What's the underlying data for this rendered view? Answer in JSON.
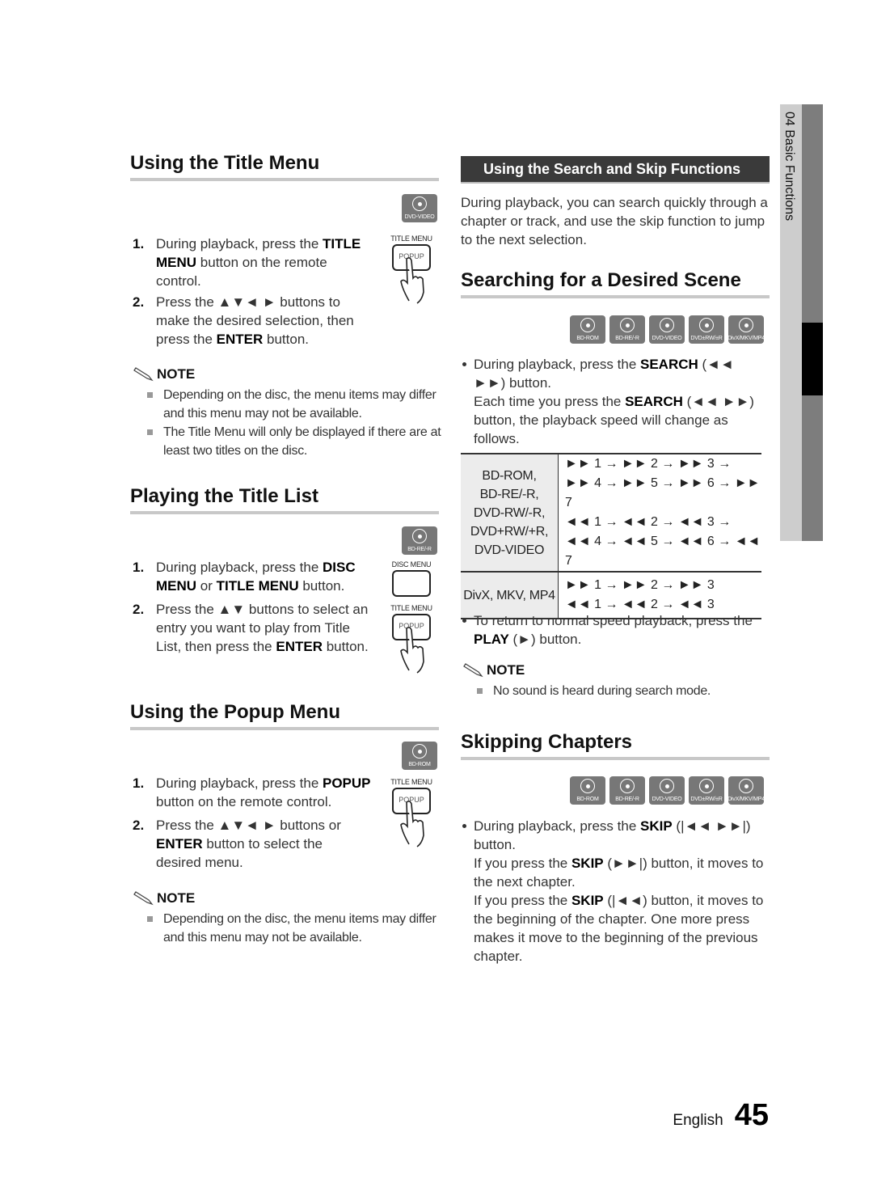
{
  "left": {
    "title_menu": {
      "heading": "Using the Title Menu",
      "disc_badge": "DVD-VIDEO",
      "remote_caption": "TITLE MENU",
      "remote_button": "POPUP",
      "steps": [
        {
          "num": "1.",
          "pre": "During playback, press the ",
          "bold": "TITLE MENU",
          "post": " button on the remote control."
        },
        {
          "num": "2.",
          "pre": "Press the ▲▼◄ ► buttons to make the desired selection, then press the ",
          "bold": "ENTER",
          "post": " button."
        }
      ],
      "note_label": "NOTE",
      "notes": [
        "Depending on the disc, the menu items may differ and this menu may not be available.",
        "The Title Menu will only be displayed if there are at least two titles on the disc."
      ]
    },
    "title_list": {
      "heading": "Playing the Title List",
      "disc_badge": "BD-RE/-R",
      "remote1_caption": "DISC MENU",
      "remote2_caption": "TITLE MENU",
      "remote2_button": "POPUP",
      "step1": {
        "num": "1.",
        "pre": "During playback, press the ",
        "bold1": "DISC MENU",
        "mid": " or ",
        "bold2": "TITLE MENU",
        "post": " button."
      },
      "step2": {
        "num": "2.",
        "pre": "Press the ▲▼ buttons to select an entry you want to play from Title List, then press the ",
        "bold": "ENTER",
        "post": " button."
      }
    },
    "popup_menu": {
      "heading": "Using the Popup Menu",
      "disc_badge": "BD-ROM",
      "remote_caption": "TITLE MENU",
      "remote_button": "POPUP",
      "step1": {
        "num": "1.",
        "pre": "During playback, press the ",
        "bold": "POPUP",
        "post": " button on the remote control."
      },
      "step2": {
        "num": "2.",
        "pre": "Press the ▲▼◄ ► buttons or ",
        "bold": "ENTER",
        "post": " button to select the desired menu."
      },
      "note_label": "NOTE",
      "notes": [
        "Depending on the disc, the menu items may differ and this menu may not be available."
      ]
    }
  },
  "right": {
    "banner": "Using the Search and Skip Functions",
    "intro": "During playback, you can search quickly through a chapter or track, and use the skip function to jump to the next selection.",
    "search": {
      "heading": "Searching for a Desired Scene",
      "disc_badges": [
        "BD-ROM",
        "BD-RE/-R",
        "DVD-VIDEO",
        "DVD±RW/±R",
        "DivX/MKV/MP4"
      ],
      "bullet1": {
        "pre": "During playback, press the ",
        "bold": "SEARCH",
        "post": " (◄◄ ►►) button.",
        "pre2": "Each time you press the ",
        "bold2": "SEARCH",
        "post2": " (◄◄ ►►) button, the playback speed will change as follows."
      },
      "table": [
        {
          "category": [
            "BD-ROM,",
            "BD-RE/-R,",
            "DVD-RW/-R,",
            "DVD+RW/+R,",
            "DVD-VIDEO"
          ],
          "sequences": [
            "►► 1 → ►► 2 → ►► 3 →",
            "►► 4 → ►► 5 → ►► 6 → ►► 7",
            "◄◄ 1 → ◄◄ 2 → ◄◄ 3 →",
            "◄◄ 4 → ◄◄ 5 → ◄◄ 6 → ◄◄ 7"
          ]
        },
        {
          "category": [
            "DivX, MKV, MP4"
          ],
          "sequences": [
            "►► 1 → ►► 2 → ►► 3",
            "◄◄ 1 → ◄◄ 2 → ◄◄ 3"
          ]
        }
      ],
      "bullet2": {
        "pre": "To return to normal speed playback, press the ",
        "bold": "PLAY",
        "post": " (►) button."
      },
      "note_label": "NOTE",
      "notes": [
        "No sound is heard during search mode."
      ]
    },
    "skip": {
      "heading": "Skipping Chapters",
      "disc_badges": [
        "BD-ROM",
        "BD-RE/-R",
        "DVD-VIDEO",
        "DVD±RW/±R",
        "DivX/MKV/MP4"
      ],
      "p1": {
        "pre": "During playback, press the ",
        "bold": "SKIP",
        "post": " (|◄◄ ►►|) button."
      },
      "p2": {
        "pre": "If you press the ",
        "bold": "SKIP",
        "post": " (►►|) button, it moves to the next chapter."
      },
      "p3": {
        "pre": "If you press the ",
        "bold": "SKIP",
        "post": " (|◄◄) button, it moves to the beginning of the chapter. One more press makes it move to the beginning of the previous chapter."
      }
    }
  },
  "side_tab": {
    "label": "04  Basic Functions"
  },
  "footer": {
    "language": "English",
    "page_number": "45"
  }
}
